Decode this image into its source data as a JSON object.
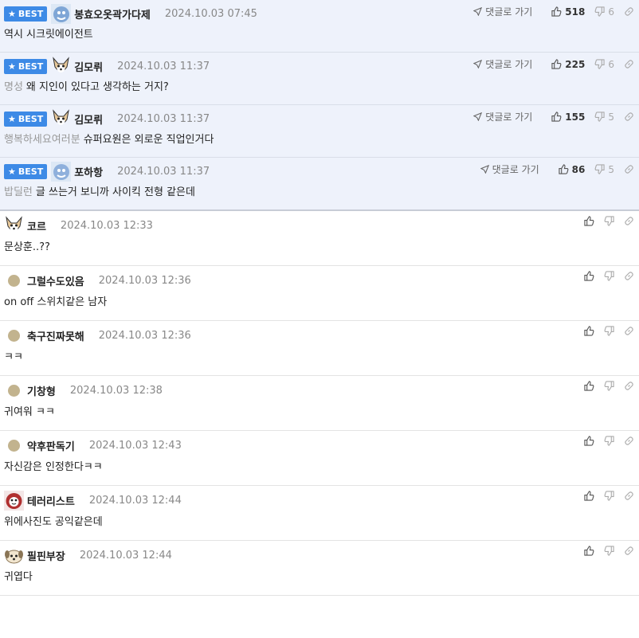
{
  "best_badge_label": "BEST",
  "reply_label": "댓글로 가기",
  "best_comments": [
    {
      "avatar": "blue-face-avatar",
      "nickname": "봉효오옷곽가다제",
      "date": "2024.10.03 07:45",
      "likes": "518",
      "dislikes": "6",
      "mention": "",
      "text": "역시 시크릿에이전트"
    },
    {
      "avatar": "dog-avatar",
      "nickname": "김모뤼",
      "date": "2024.10.03 11:37",
      "likes": "225",
      "dislikes": "6",
      "mention": "명성",
      "text": "왜 지인이 있다고 생각하는 거지?"
    },
    {
      "avatar": "dog-avatar",
      "nickname": "김모뤼",
      "date": "2024.10.03 11:37",
      "likes": "155",
      "dislikes": "5",
      "mention": "행복하세요여러분",
      "text": "슈퍼요원은 외로운 직업인거다"
    },
    {
      "avatar": "blue-face-avatar",
      "nickname": "포하항",
      "date": "2024.10.03 11:37",
      "likes": "86",
      "dislikes": "5",
      "mention": "밥딜런",
      "text": "글 쓰는거 보니까 사이킥 전형 같은데"
    }
  ],
  "comments": [
    {
      "avatar": "dog-avatar",
      "nickname": "코르",
      "date": "2024.10.03 12:33",
      "text": "문상훈..??"
    },
    {
      "avatar": "dot",
      "nickname": "그럴수도있음",
      "date": "2024.10.03 12:36",
      "text": "on off 스위치같은 남자"
    },
    {
      "avatar": "dot",
      "nickname": "축구진짜못해",
      "date": "2024.10.03 12:36",
      "text": "ㅋㅋ"
    },
    {
      "avatar": "dot",
      "nickname": "기창형",
      "date": "2024.10.03 12:38",
      "text": "귀여워 ㅋㅋ"
    },
    {
      "avatar": "dot",
      "nickname": "약후판독기",
      "date": "2024.10.03 12:43",
      "text": "자신감은 인정한다ㅋㅋ"
    },
    {
      "avatar": "red-face-avatar",
      "nickname": "테러리스트",
      "date": "2024.10.03 12:44",
      "text": "위에사진도 공익같은데"
    },
    {
      "avatar": "puppy-avatar",
      "nickname": "필핀부장",
      "date": "2024.10.03 12:44",
      "text": "귀엽다"
    }
  ],
  "colors": {
    "badge": "#3d8ae6",
    "best_bg": "#eef2fb",
    "dot": "#c2b38e"
  }
}
